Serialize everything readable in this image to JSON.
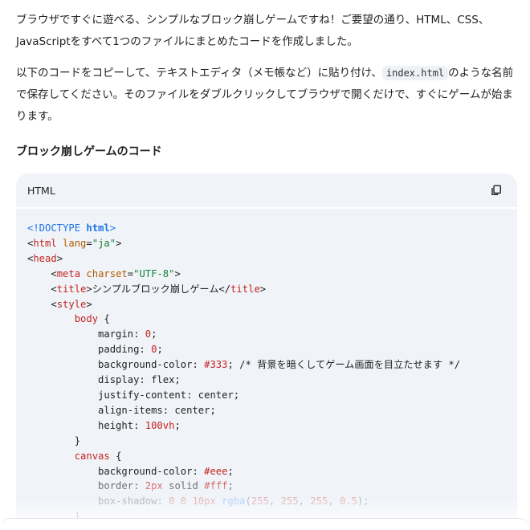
{
  "intro": {
    "p1": "ブラウザですぐに遊べる、シンプルなブロック崩しゲームですね！ご要望の通り、HTML、CSS、JavaScriptをすべて1つのファイルにまとめたコードを作成しました。",
    "p2_before": "以下のコードをコピーして、テキストエディタ（メモ帳など）に貼り付け、",
    "p2_code": "index.html",
    "p2_after": "のような名前で保存してください。そのファイルをダブルクリックしてブラウザで開くだけで、すぐにゲームが始まります。"
  },
  "section_heading": "ブロック崩しゲームのコード",
  "code_block": {
    "language": "HTML",
    "copy_icon": "copy-icon",
    "lines": [
      [
        [
          "t-doc",
          "<!DOCTYPE "
        ],
        [
          "t-kw",
          "html"
        ],
        [
          "t-doc",
          ">"
        ]
      ],
      [
        [
          "t-pun",
          "<"
        ],
        [
          "t-tag",
          "html"
        ],
        [
          "t-pun",
          " "
        ],
        [
          "t-attr",
          "lang"
        ],
        [
          "t-pun",
          "="
        ],
        [
          "t-str",
          "\"ja\""
        ],
        [
          "t-pun",
          ">"
        ]
      ],
      [
        [
          "t-pun",
          "<"
        ],
        [
          "t-tag",
          "head"
        ],
        [
          "t-pun",
          ">"
        ]
      ],
      [
        [
          "t-pun",
          "    <"
        ],
        [
          "t-tag",
          "meta"
        ],
        [
          "t-pun",
          " "
        ],
        [
          "t-attr",
          "charset"
        ],
        [
          "t-pun",
          "="
        ],
        [
          "t-str",
          "\"UTF-8\""
        ],
        [
          "t-pun",
          ">"
        ]
      ],
      [
        [
          "t-pun",
          "    <"
        ],
        [
          "t-tag",
          "title"
        ],
        [
          "t-pun",
          ">シンプルブロック崩しゲーム</"
        ],
        [
          "t-tag",
          "title"
        ],
        [
          "t-pun",
          ">"
        ]
      ],
      [
        [
          "t-pun",
          "    <"
        ],
        [
          "t-tag",
          "style"
        ],
        [
          "t-pun",
          ">"
        ]
      ],
      [
        [
          "t-pun",
          "        "
        ],
        [
          "t-sel",
          "body"
        ],
        [
          "t-pun",
          " {"
        ]
      ],
      [
        [
          "t-prop",
          "            margin: "
        ],
        [
          "t-num",
          "0"
        ],
        [
          "t-pun",
          ";"
        ]
      ],
      [
        [
          "t-prop",
          "            padding: "
        ],
        [
          "t-num",
          "0"
        ],
        [
          "t-pun",
          ";"
        ]
      ],
      [
        [
          "t-prop",
          "            background-color: "
        ],
        [
          "t-num",
          "#333"
        ],
        [
          "t-pun",
          "; "
        ],
        [
          "t-cm",
          "/* 背景を暗くしてゲーム画面を目立たせます */"
        ]
      ],
      [
        [
          "t-prop",
          "            display: flex;"
        ]
      ],
      [
        [
          "t-prop",
          "            justify-content: center;"
        ]
      ],
      [
        [
          "t-prop",
          "            align-items: center;"
        ]
      ],
      [
        [
          "t-prop",
          "            height: "
        ],
        [
          "t-num",
          "100vh"
        ],
        [
          "t-pun",
          ";"
        ]
      ],
      [
        [
          "t-pun",
          "        }"
        ]
      ],
      [
        [
          "t-pun",
          "        "
        ],
        [
          "t-sel",
          "canvas"
        ],
        [
          "t-pun",
          " {"
        ]
      ],
      [
        [
          "t-prop",
          "            background-color: "
        ],
        [
          "t-num",
          "#eee"
        ],
        [
          "t-pun",
          ";"
        ]
      ],
      [
        [
          "t-prop",
          "            border: "
        ],
        [
          "t-num",
          "2px"
        ],
        [
          "t-prop",
          " solid "
        ],
        [
          "t-num",
          "#fff"
        ],
        [
          "t-pun",
          ";"
        ]
      ],
      [
        [
          "t-prop",
          "            box-shadow: "
        ],
        [
          "t-num",
          "0 0 10px "
        ],
        [
          "t-fn",
          "rgba"
        ],
        [
          "t-pun",
          "("
        ],
        [
          "t-num",
          "255"
        ],
        [
          "t-pun",
          ", "
        ],
        [
          "t-num",
          "255"
        ],
        [
          "t-pun",
          ", "
        ],
        [
          "t-num",
          "255"
        ],
        [
          "t-pun",
          ", "
        ],
        [
          "t-num",
          "0.5"
        ],
        [
          "t-pun",
          ");"
        ]
      ],
      [
        [
          "t-pun",
          "        }"
        ]
      ]
    ]
  },
  "colors": {
    "code_bg": "#f0f4f9",
    "tag": "#c5221f",
    "attr": "#b55a00",
    "string": "#188038",
    "keyword": "#1a73e8"
  }
}
